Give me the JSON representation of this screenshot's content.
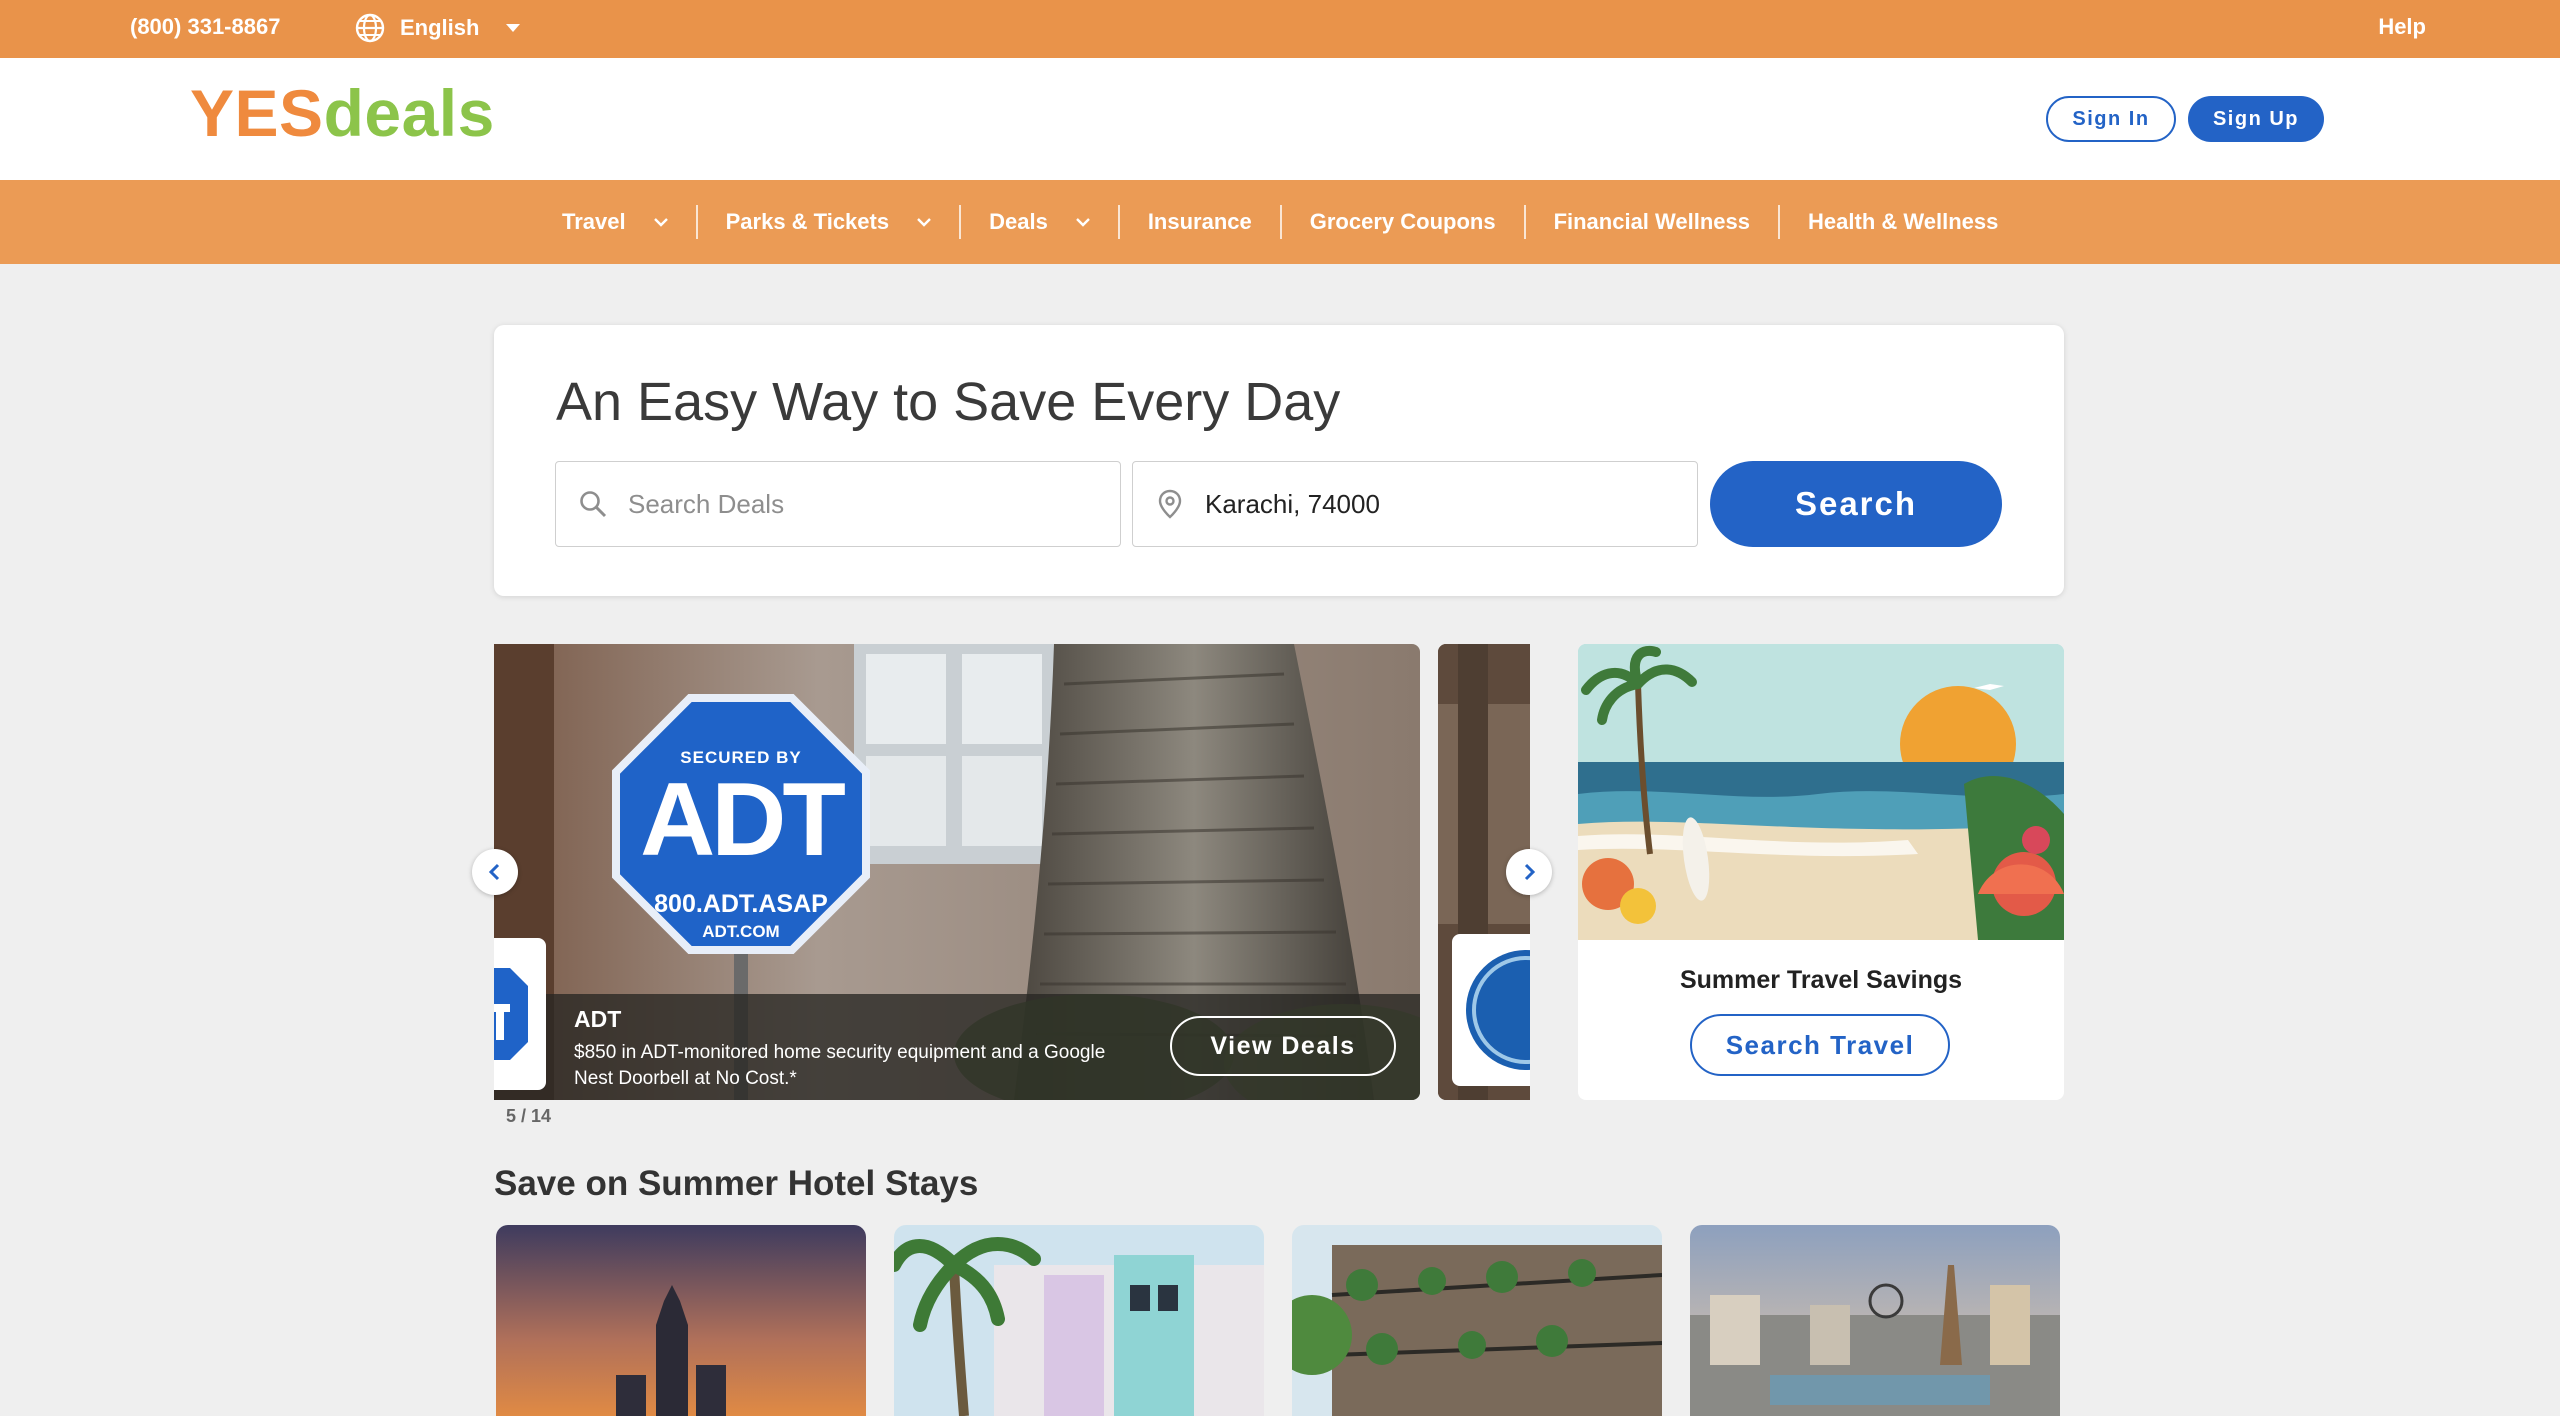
{
  "topbar": {
    "phone": "(800) 331-8867",
    "language": "English",
    "help": "Help"
  },
  "header": {
    "logo_yes": "YES",
    "logo_deals": "deals",
    "sign_in": "Sign In",
    "sign_up": "Sign Up"
  },
  "nav": {
    "items": [
      {
        "label": "Travel"
      },
      {
        "label": "Parks & Tickets"
      },
      {
        "label": "Deals"
      },
      {
        "label": "Insurance"
      },
      {
        "label": "Grocery Coupons"
      },
      {
        "label": "Financial Wellness"
      },
      {
        "label": "Health & Wellness"
      }
    ]
  },
  "hero": {
    "title": "An Easy Way to Save Every Day",
    "search_placeholder": "Search Deals",
    "location_value": "Karachi, 74000",
    "search_button": "Search"
  },
  "carousel": {
    "sign_top": "SECURED BY",
    "sign_brand": "ADT",
    "sign_phone": "800.ADT.ASAP",
    "sign_web": "ADT.COM",
    "slide_title": "ADT",
    "slide_desc": "$850 in ADT-monitored home security equipment and a Google Nest Doorbell at No Cost.*",
    "view_button": "View Deals",
    "counter": "5 / 14"
  },
  "promo": {
    "title": "Summer Travel Savings",
    "button": "Search Travel"
  },
  "hotels": {
    "section_title": "Save on Summer Hotel Stays"
  },
  "colors": {
    "orange": "#e9934a",
    "nav_orange": "#eb9b55",
    "blue": "#2363c6",
    "logo_orange": "#ef8a3e",
    "logo_green": "#8cc44a"
  }
}
